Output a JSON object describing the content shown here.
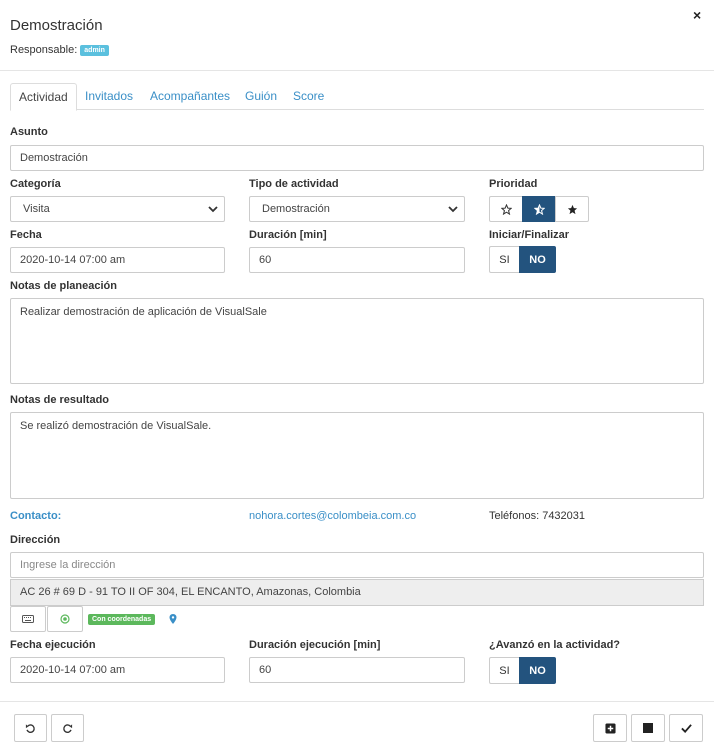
{
  "header": {
    "title": "Demostración",
    "responsable_label": "Responsable:",
    "responsable_value": "admin",
    "close_glyph": "×"
  },
  "tabs": [
    {
      "label": "Actividad",
      "active": true
    },
    {
      "label": "Invitados"
    },
    {
      "label": "Acompañantes"
    },
    {
      "label": "Guión"
    },
    {
      "label": "Score"
    }
  ],
  "form": {
    "asunto": {
      "label": "Asunto",
      "value": "Demostración"
    },
    "categoria": {
      "label": "Categoría",
      "value": "Visita"
    },
    "tipo": {
      "label": "Tipo de actividad",
      "value": "Demostración"
    },
    "prioridad": {
      "label": "Prioridad",
      "icons": [
        "star-empty-icon",
        "star-half-icon",
        "star-full-icon"
      ],
      "selected": 2
    },
    "fecha": {
      "label": "Fecha",
      "value": "2020-10-14 07:00 am"
    },
    "duracion": {
      "label": "Duración [min]",
      "value": "60"
    },
    "iniciar": {
      "label": "Iniciar/Finalizar",
      "si": "SI",
      "no": "NO",
      "selected": "NO"
    },
    "notas_planeacion": {
      "label": "Notas de planeación",
      "value": "Realizar demostración de aplicación de VisualSale"
    },
    "notas_resultado": {
      "label": "Notas de resultado",
      "value": "Se realizó demostración de VisualSale."
    },
    "contacto": {
      "label": "Contacto:",
      "email": "nohora.cortes@colombeia.com.co",
      "telefonos": "Teléfonos: 7432031"
    },
    "direccion": {
      "label": "Dirección",
      "placeholder": "Ingrese la dirección",
      "result": "AC 26 # 69 D - 91 TO II OF 304, EL ENCANTO, Amazonas, Colombia",
      "badge": "Con coordenadas"
    },
    "fecha_ejecucion": {
      "label": "Fecha ejecución",
      "value": "2020-10-14 07:00 am"
    },
    "duracion_ejecucion": {
      "label": "Duración ejecución [min]",
      "value": "60"
    },
    "avanzo": {
      "label": "¿Avanzó en la actividad?",
      "si": "SI",
      "no": "NO",
      "selected": "NO"
    }
  },
  "colors": {
    "primary": "#23537e",
    "link": "#3a8fc7",
    "info": "#5bc0de",
    "success": "#5cb85c"
  }
}
